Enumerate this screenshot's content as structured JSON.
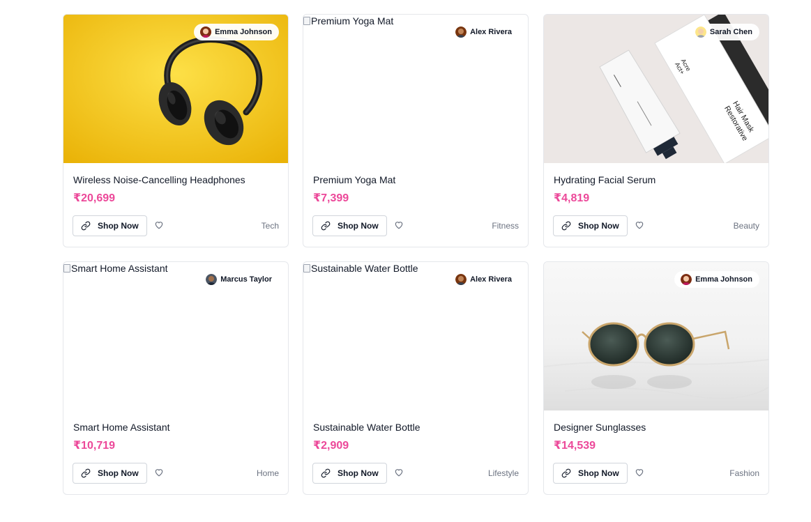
{
  "cards": [
    {
      "title": "Wireless Noise-Cancelling Headphones",
      "price": "₹20,699",
      "button": "Shop Now",
      "category": "Tech",
      "author": "Emma Johnson",
      "image_alt": "",
      "image": "yellow-headphones-photo"
    },
    {
      "title": "Premium Yoga Mat",
      "price": "₹7,399",
      "button": "Shop Now",
      "category": "Fitness",
      "author": "Alex Rivera",
      "image_alt": "Premium Yoga Mat",
      "image": "broken-image"
    },
    {
      "title": "Hydrating Facial Serum",
      "price": "₹4,819",
      "button": "Shop Now",
      "category": "Beauty",
      "author": "Sarah Chen",
      "image_alt": "",
      "image": "skincare-product-photo",
      "image_text": [
        "Act+",
        "Acre",
        "Restorative",
        "Hair Mask"
      ]
    },
    {
      "title": "Smart Home Assistant",
      "price": "₹10,719",
      "button": "Shop Now",
      "category": "Home",
      "author": "Marcus Taylor",
      "image_alt": "Smart Home Assistant",
      "image": "broken-image"
    },
    {
      "title": "Sustainable Water Bottle",
      "price": "₹2,909",
      "button": "Shop Now",
      "category": "Lifestyle",
      "author": "Alex Rivera",
      "image_alt": "Sustainable Water Bottle",
      "image": "broken-image"
    },
    {
      "title": "Designer Sunglasses",
      "price": "₹14,539",
      "button": "Shop Now",
      "category": "Fashion",
      "author": "Emma Johnson",
      "image_alt": "",
      "image": "sunglasses-photo"
    }
  ],
  "icons": {
    "shop": "link-icon",
    "like": "heart-icon"
  },
  "colors": {
    "price": "#ec4899",
    "border": "#e5e7eb",
    "muted": "#6b7280"
  }
}
